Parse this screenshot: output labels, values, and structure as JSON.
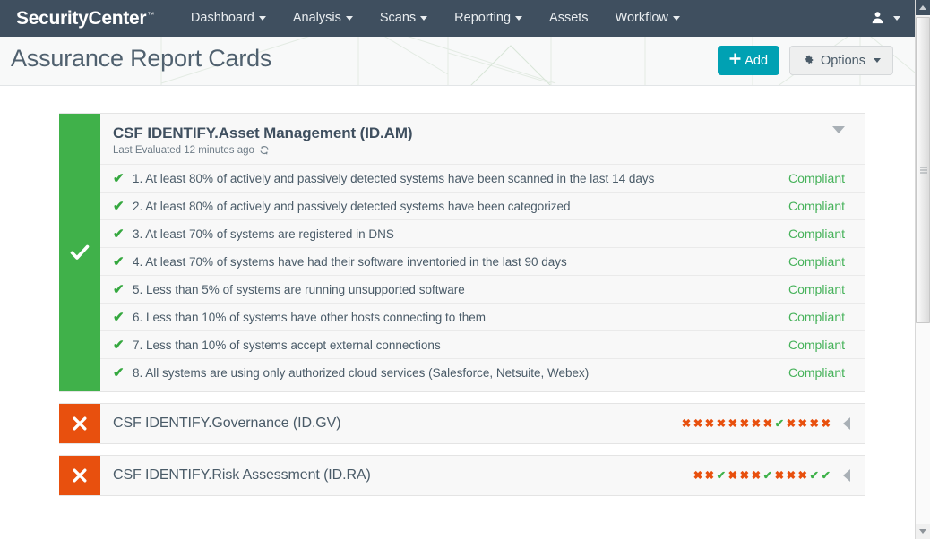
{
  "navbar": {
    "brand": "SecurityCenter",
    "brand_tm": "™",
    "items": [
      {
        "label": "Dashboard",
        "has_caret": true
      },
      {
        "label": "Analysis",
        "has_caret": true
      },
      {
        "label": "Scans",
        "has_caret": true
      },
      {
        "label": "Reporting",
        "has_caret": true
      },
      {
        "label": "Assets",
        "has_caret": false
      },
      {
        "label": "Workflow",
        "has_caret": true
      }
    ],
    "user_icon": "user-icon",
    "user_glyph": "♟"
  },
  "header": {
    "title": "Assurance Report Cards",
    "add_label": "Add",
    "add_plus": "➕",
    "options_label": "Options",
    "options_gear": "⚙",
    "accent_color": "#00a1b3"
  },
  "colors": {
    "pass_green": "#40b14a",
    "fail_orange": "#e8500e",
    "navbar_bg": "#3f4f5f",
    "compliant_text": "#46b25a"
  },
  "cards": [
    {
      "id": "csf-identify-asset-management",
      "status": "pass",
      "status_glyph": "✔",
      "title": "CSF IDENTIFY.Asset Management (ID.AM)",
      "last_evaluated": "Last Evaluated 12 minutes ago",
      "refresh_icon": "refresh-icon",
      "expanded": true,
      "toggle_icon": "chevron-down-icon",
      "policies": [
        {
          "num": "1.",
          "text": "1. At least 80% of actively and passively detected systems have been scanned in the last 14 days",
          "result": "Compliant",
          "status": "pass",
          "glyph": "✔"
        },
        {
          "num": "2.",
          "text": "2. At least 80% of actively and passively detected systems have been categorized",
          "result": "Compliant",
          "status": "pass",
          "glyph": "✔"
        },
        {
          "num": "3.",
          "text": "3. At least 70% of systems are registered in DNS",
          "result": "Compliant",
          "status": "pass",
          "glyph": "✔"
        },
        {
          "num": "4.",
          "text": "4. At least 70% of systems have had their software inventoried in the last 90 days",
          "result": "Compliant",
          "status": "pass",
          "glyph": "✔"
        },
        {
          "num": "5.",
          "text": "5. Less than 5% of systems are running unsupported software",
          "result": "Compliant",
          "status": "pass",
          "glyph": "✔"
        },
        {
          "num": "6.",
          "text": "6. Less than 10% of systems have other hosts connecting to them",
          "result": "Compliant",
          "status": "pass",
          "glyph": "✔"
        },
        {
          "num": "7.",
          "text": "7. Less than 10% of systems accept external connections",
          "result": "Compliant",
          "status": "pass",
          "glyph": "✔"
        },
        {
          "num": "8.",
          "text": "8. All systems are using only authorized cloud services (Salesforce, Netsuite, Webex)",
          "result": "Compliant",
          "status": "pass",
          "glyph": "✔"
        }
      ]
    },
    {
      "id": "csf-identify-governance",
      "status": "fail",
      "status_glyph": "✖",
      "title": "CSF IDENTIFY.Governance (ID.GV)",
      "expanded": false,
      "toggle_icon": "chevron-left-icon",
      "summary": [
        "fail",
        "fail",
        "fail",
        "fail",
        "fail",
        "fail",
        "fail",
        "fail",
        "pass",
        "fail",
        "fail",
        "fail",
        "fail"
      ],
      "summary_glyphs": {
        "pass": "✔",
        "fail": "✖"
      }
    },
    {
      "id": "csf-identify-risk-assessment",
      "status": "fail",
      "status_glyph": "✖",
      "title": "CSF IDENTIFY.Risk Assessment (ID.RA)",
      "expanded": false,
      "toggle_icon": "chevron-left-icon",
      "summary": [
        "fail",
        "fail",
        "pass",
        "fail",
        "fail",
        "fail",
        "pass",
        "fail",
        "fail",
        "fail",
        "pass",
        "pass"
      ],
      "summary_glyphs": {
        "pass": "✔",
        "fail": "✖"
      }
    }
  ],
  "scrollbar": {
    "up_icon": "scroll-up-arrow-icon",
    "down_icon": "scroll-down-arrow-icon",
    "thumb": "scrollbar-thumb"
  }
}
